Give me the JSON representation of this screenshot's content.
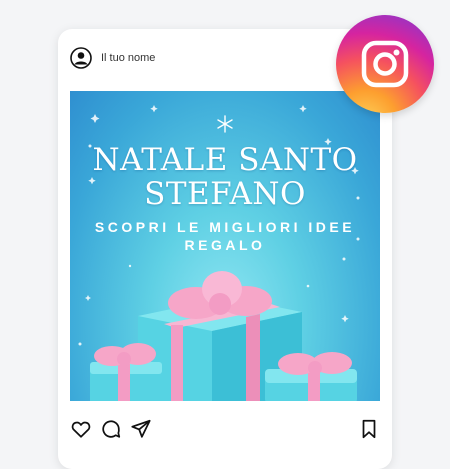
{
  "post": {
    "username": "Il tuo nome",
    "title_line1": "NATALE SANTO",
    "title_line2": "STEFANO",
    "subtitle": "SCOPRI LE MIGLIORI IDEE REGALO"
  },
  "icons": {
    "avatar": "user-circle-icon",
    "like": "heart-icon",
    "comment": "speech-bubble-icon",
    "share": "paper-plane-icon",
    "save": "bookmark-icon",
    "brand": "instagram-logo-icon"
  },
  "colors": {
    "image_background": "#3aa7d8",
    "gift_box": "#4fd0e0",
    "gift_ribbon": "#f6a6c8"
  }
}
